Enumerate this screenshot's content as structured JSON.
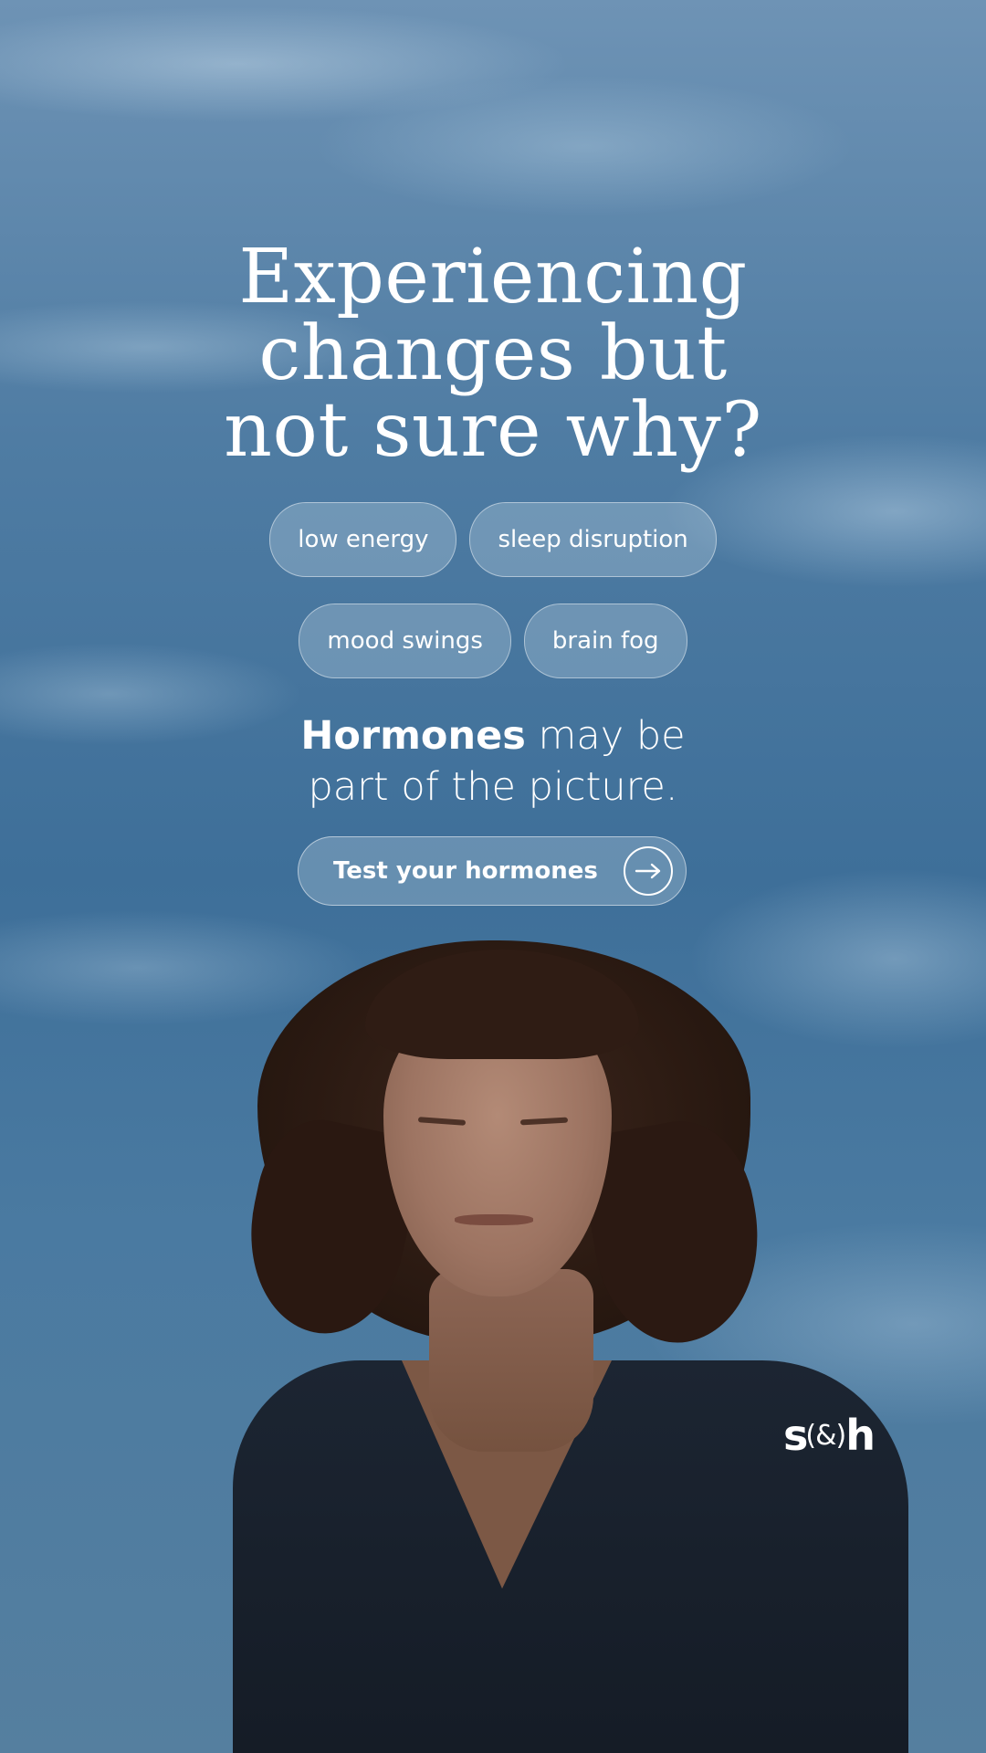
{
  "headline": {
    "line1": "Experiencing",
    "line2": "changes but",
    "line3": "not sure why?"
  },
  "symptoms": [
    "low energy",
    "sleep disruption",
    "mood swings",
    "brain fog"
  ],
  "tagline": {
    "bold": "Hormones",
    "rest1": " may be",
    "rest2": "part of the picture."
  },
  "cta": {
    "label": "Test your hormones",
    "icon": "arrow-right-circle-icon"
  },
  "brand": {
    "logo_s": "s",
    "logo_amp": "(&)",
    "logo_h": "h"
  },
  "colors": {
    "text": "#ffffff",
    "sky": "#3e6f99",
    "chip_fill": "rgba(210,225,238,0.28)"
  }
}
